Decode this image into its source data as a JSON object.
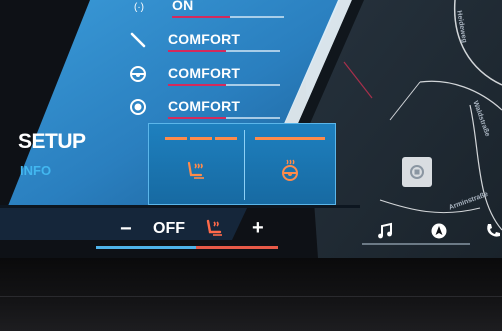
{
  "seat_settings": {
    "items": [
      {
        "icon": "massage-icon",
        "label": "ON"
      },
      {
        "icon": "backrest-icon",
        "label": "COMFORT"
      },
      {
        "icon": "steering-wheel-icon",
        "label": "COMFORT"
      },
      {
        "icon": "seat-ventilation-icon",
        "label": "COMFORT"
      }
    ]
  },
  "sidebar": {
    "title": "SETUP",
    "info": "INFO"
  },
  "heat_popup": {
    "seat_heat": {
      "icon": "seat-heat-icon",
      "level": 3,
      "max_level": 3
    },
    "wheel_heat": {
      "icon": "steering-wheel-heat-icon",
      "level": 1,
      "max_level": 1
    }
  },
  "climate_bar": {
    "minus": "−",
    "status": "OFF",
    "plus": "+",
    "seat_icon": "seat-heat-icon"
  },
  "media_bar": {
    "icons": [
      "music-note-icon",
      "navigation-icon",
      "phone-icon"
    ]
  },
  "map": {
    "streets": [
      "Heideweg",
      "Waldstraße",
      "Arminstraße"
    ],
    "recenter_icon": "recenter-icon"
  },
  "colors": {
    "accent_blue": "#1f7fc0",
    "heat_orange": "#ff8b4a",
    "slider_magenta": "#d52a5c",
    "info_blue": "#42b7f0"
  }
}
